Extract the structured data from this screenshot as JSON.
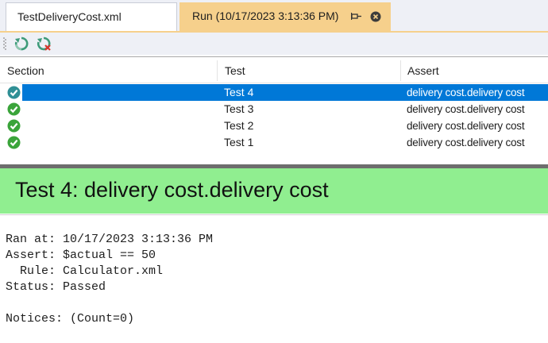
{
  "tabs": {
    "file_tab": {
      "label": "TestDeliveryCost.xml"
    },
    "run_tab": {
      "label": "Run (10/17/2023 3:13:36 PM)"
    }
  },
  "icons": {
    "pin": "pin-icon",
    "close": "close-icon",
    "rerun": "rerun-icon",
    "rerun_failed": "rerun-failed-icon",
    "status_passed": "check-circle-icon"
  },
  "colors": {
    "run_tab_bg": "#f6d08c",
    "selection": "#0078d7",
    "passed_banner": "#90ee90",
    "passed_icon": "#3aa43a"
  },
  "grid": {
    "columns": [
      "Section",
      "Test",
      "Assert"
    ],
    "rows": [
      {
        "section": "",
        "test": "Test 4",
        "assert": "delivery cost.delivery cost",
        "status": "passed",
        "selected": true
      },
      {
        "section": "",
        "test": "Test 3",
        "assert": "delivery cost.delivery cost",
        "status": "passed",
        "selected": false
      },
      {
        "section": "",
        "test": "Test 2",
        "assert": "delivery cost.delivery cost",
        "status": "passed",
        "selected": false
      },
      {
        "section": "",
        "test": "Test 1",
        "assert": "delivery cost.delivery cost",
        "status": "passed",
        "selected": false
      }
    ]
  },
  "banner": {
    "title": "Test 4: delivery cost.delivery cost"
  },
  "details": {
    "ran_at": "Ran at: 10/17/2023 3:13:36 PM",
    "assert": "Assert: $actual == 50",
    "rule": "  Rule: Calculator.xml",
    "status": "Status: Passed",
    "notices": "Notices: (Count=0)"
  }
}
